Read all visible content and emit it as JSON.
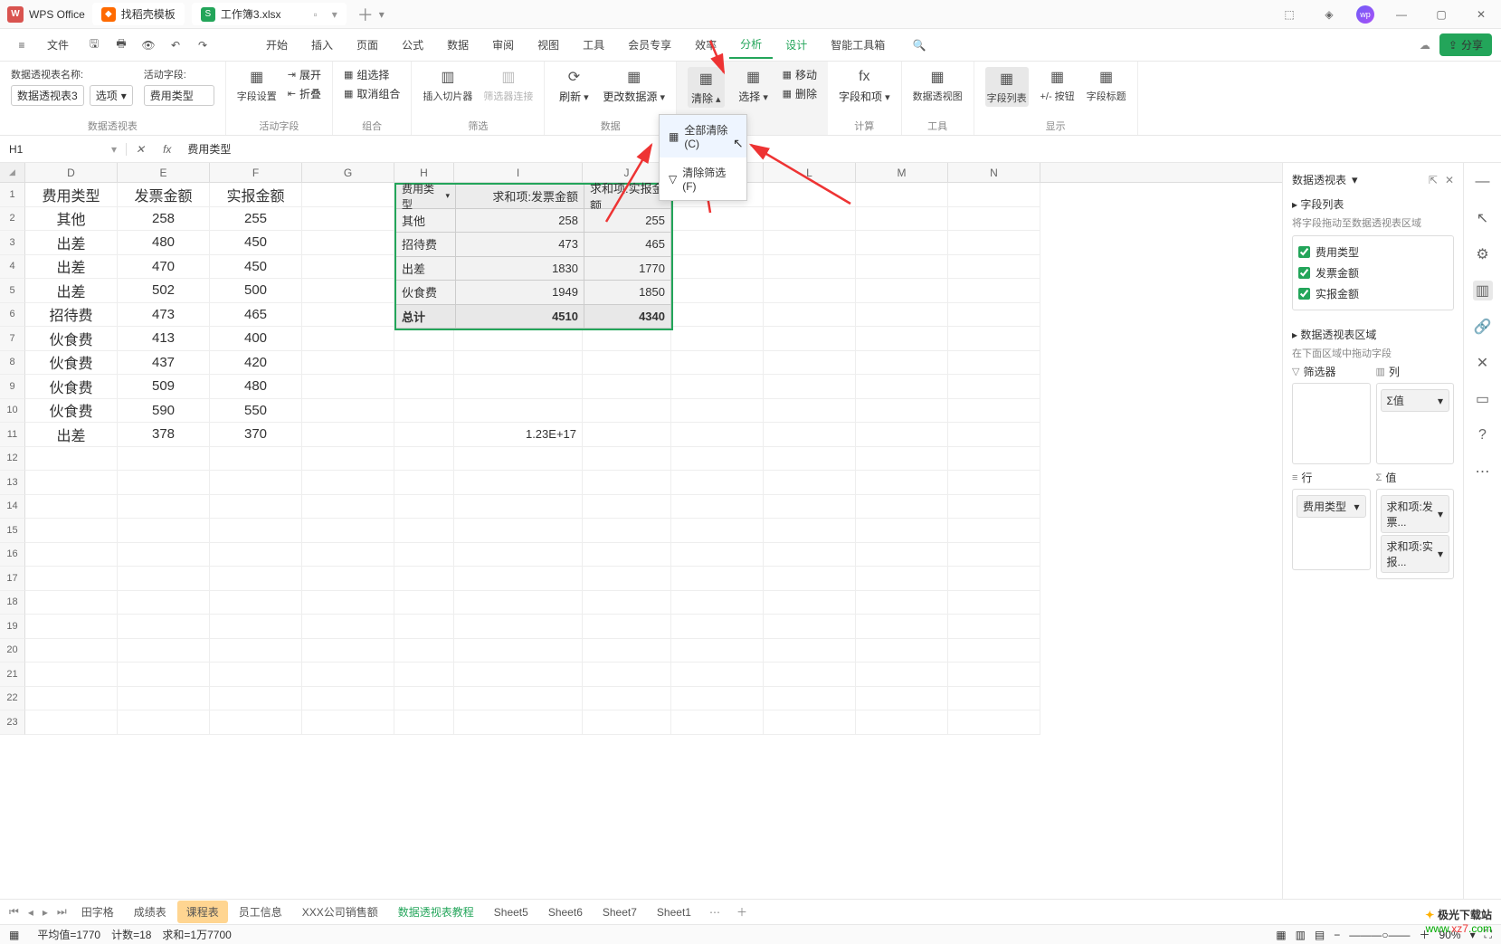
{
  "titlebar": {
    "app": "WPS Office",
    "tab1": "找稻壳模板",
    "tab2": "工作簿3.xlsx"
  },
  "menu": {
    "file": "文件",
    "items": [
      "开始",
      "插入",
      "页面",
      "公式",
      "数据",
      "审阅",
      "视图",
      "工具",
      "会员专享",
      "效率",
      "分析",
      "设计",
      "智能工具箱"
    ],
    "share": "分享"
  },
  "ribbon": {
    "g1": {
      "nameLabel": "数据透视表名称:",
      "name": "数据透视表3",
      "opt": "选项",
      "activeLabel": "活动字段:",
      "active": "费用类型",
      "group": "数据透视表"
    },
    "g2": {
      "fieldSet": "字段设置",
      "expand": "展开",
      "collapse": "折叠",
      "group": "活动字段"
    },
    "g3": {
      "selGroup": "组选择",
      "ungroup": "取消组合",
      "group": "组合"
    },
    "g4": {
      "slicer": "插入切片器",
      "conn": "筛选器连接",
      "group": "筛选"
    },
    "g5": {
      "refresh": "刷新",
      "changeSrc": "更改数据源",
      "group": "数据"
    },
    "g6": {
      "clear": "清除",
      "select": "选择",
      "move": "移动",
      "del": "删除"
    },
    "g7": {
      "fieldItem": "字段和项",
      "group": "计算"
    },
    "g8": {
      "chart": "数据透视图",
      "group": "工具"
    },
    "g9": {
      "fieldList": "字段列表",
      "btns": "+/- 按钮",
      "headers": "字段标题",
      "group": "显示"
    }
  },
  "dropdown": {
    "clearAll": "全部清除(C)",
    "clearFilter": "清除筛选(F)"
  },
  "namebox": "H1",
  "formula": "费用类型",
  "cols": [
    "D",
    "E",
    "F",
    "G",
    "H",
    "I",
    "J",
    "K",
    "L",
    "M",
    "N"
  ],
  "source": {
    "headers": [
      "费用类型",
      "发票金额",
      "实报金额"
    ],
    "rows": [
      [
        "其他",
        "258",
        "255"
      ],
      [
        "出差",
        "480",
        "450"
      ],
      [
        "出差",
        "470",
        "450"
      ],
      [
        "出差",
        "502",
        "500"
      ],
      [
        "招待费",
        "473",
        "465"
      ],
      [
        "伙食费",
        "413",
        "400"
      ],
      [
        "伙食费",
        "437",
        "420"
      ],
      [
        "伙食费",
        "509",
        "480"
      ],
      [
        "伙食费",
        "590",
        "550"
      ],
      [
        "出差",
        "378",
        "370"
      ]
    ]
  },
  "extra": {
    "i11": "1.23E+17"
  },
  "pivot": {
    "h1": "费用类型",
    "h2": "求和项:发票金额",
    "h3": "求和项:实报金额",
    "rows": [
      [
        "其他",
        "258",
        "255"
      ],
      [
        "招待费",
        "473",
        "465"
      ],
      [
        "出差",
        "1830",
        "1770"
      ],
      [
        "伙食费",
        "1949",
        "1850"
      ]
    ],
    "total": [
      "总计",
      "4510",
      "4340"
    ]
  },
  "panel": {
    "title": "数据透视表",
    "fieldList": "字段列表",
    "hint": "将字段拖动至数据透视表区域",
    "fields": [
      "费用类型",
      "发票金额",
      "实报金额"
    ],
    "areaTitle": "数据透视表区域",
    "areaHint": "在下面区域中拖动字段",
    "filter": "筛选器",
    "column": "列",
    "row": "行",
    "value": "值",
    "colVal": "Σ值",
    "rowVal": "费用类型",
    "val1": "求和项:发票...",
    "val2": "求和项:实报..."
  },
  "tabs": {
    "nav": [
      "田字格",
      "成绩表",
      "课程表",
      "员工信息",
      "XXX公司销售额",
      "数据透视表教程",
      "Sheet5",
      "Sheet6",
      "Sheet7",
      "Sheet1"
    ]
  },
  "status": {
    "avg": "平均值=1770",
    "count": "计数=18",
    "sum": "求和=1万7700",
    "zoom": "90%"
  },
  "watermark": "极光下载站",
  "watermarkUrl": "www.xz7.com"
}
